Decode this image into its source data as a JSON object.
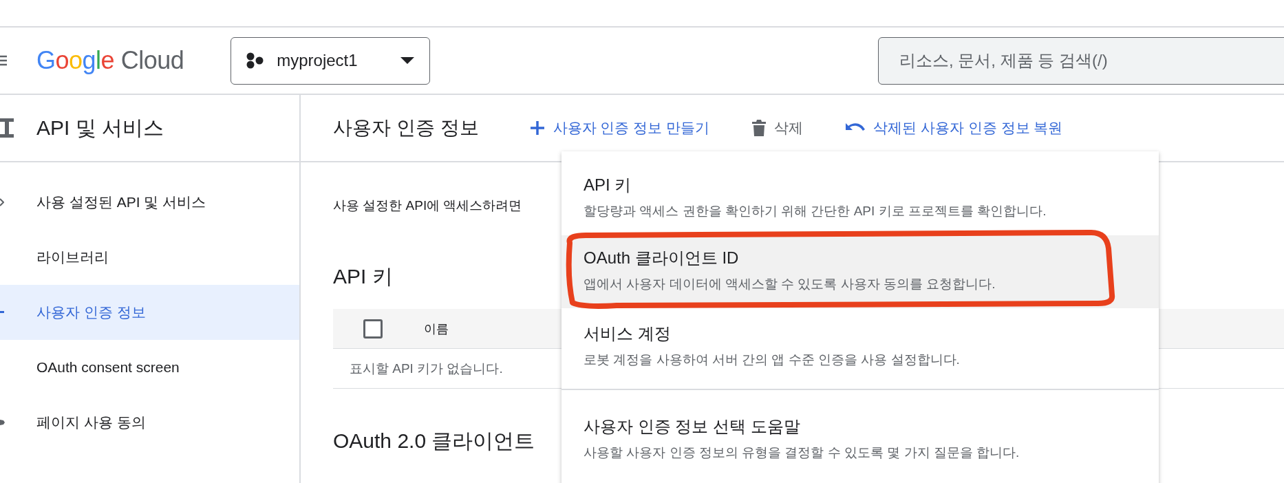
{
  "header": {
    "logo": "Google Cloud",
    "project": "myproject1",
    "search": {
      "placeholder": "리소스, 문서, 제품 등 검색(/)"
    }
  },
  "sidebar": {
    "title": "API 및 서비스",
    "items": [
      {
        "label": "사용 설정된 API 및 서비스",
        "selected": false
      },
      {
        "label": "라이브러리",
        "selected": false
      },
      {
        "label": "사용자 인증 정보",
        "selected": true
      },
      {
        "label": "OAuth consent screen",
        "selected": false
      },
      {
        "label": "페이지 사용 동의",
        "selected": false
      }
    ]
  },
  "page": {
    "title": "사용자 인증 정보",
    "toolbar": [
      {
        "kind": "create",
        "label": "사용자 인증 정보 만들기"
      },
      {
        "kind": "delete",
        "label": "삭제"
      },
      {
        "kind": "restore",
        "label": "삭제된 사용자 인증 정보 복원"
      }
    ],
    "intro": "사용 설정한 API에 액세스하려면",
    "api_keys": {
      "title": "API 키",
      "columns": [
        "이름"
      ],
      "select_all_checked": false,
      "empty": "표시할 API 키가 없습니다."
    },
    "oauth_title": "OAuth 2.0 클라이언트"
  },
  "create_menu": {
    "items": [
      {
        "title": "API 키",
        "description": "할당량과 액세스 권한을 확인하기 위해 간단한 API 키로 프로젝트를 확인합니다.",
        "highlighted": false,
        "divider_before": false
      },
      {
        "title": "OAuth 클라이언트 ID",
        "description": "앱에서 사용자 데이터에 액세스할 수 있도록 사용자 동의를 요청합니다.",
        "highlighted": true,
        "divider_before": false
      },
      {
        "title": "서비스 계정",
        "description": "로봇 계정을 사용하여 서버 간의 앱 수준 인증을 사용 설정합니다.",
        "highlighted": false,
        "divider_before": false
      },
      {
        "title": "사용자 인증 정보 선택 도움말",
        "description": "사용할 사용자 인증 정보의 유형을 결정할 수 있도록 몇 가지 질문을 합니다.",
        "highlighted": false,
        "divider_before": true
      }
    ]
  }
}
